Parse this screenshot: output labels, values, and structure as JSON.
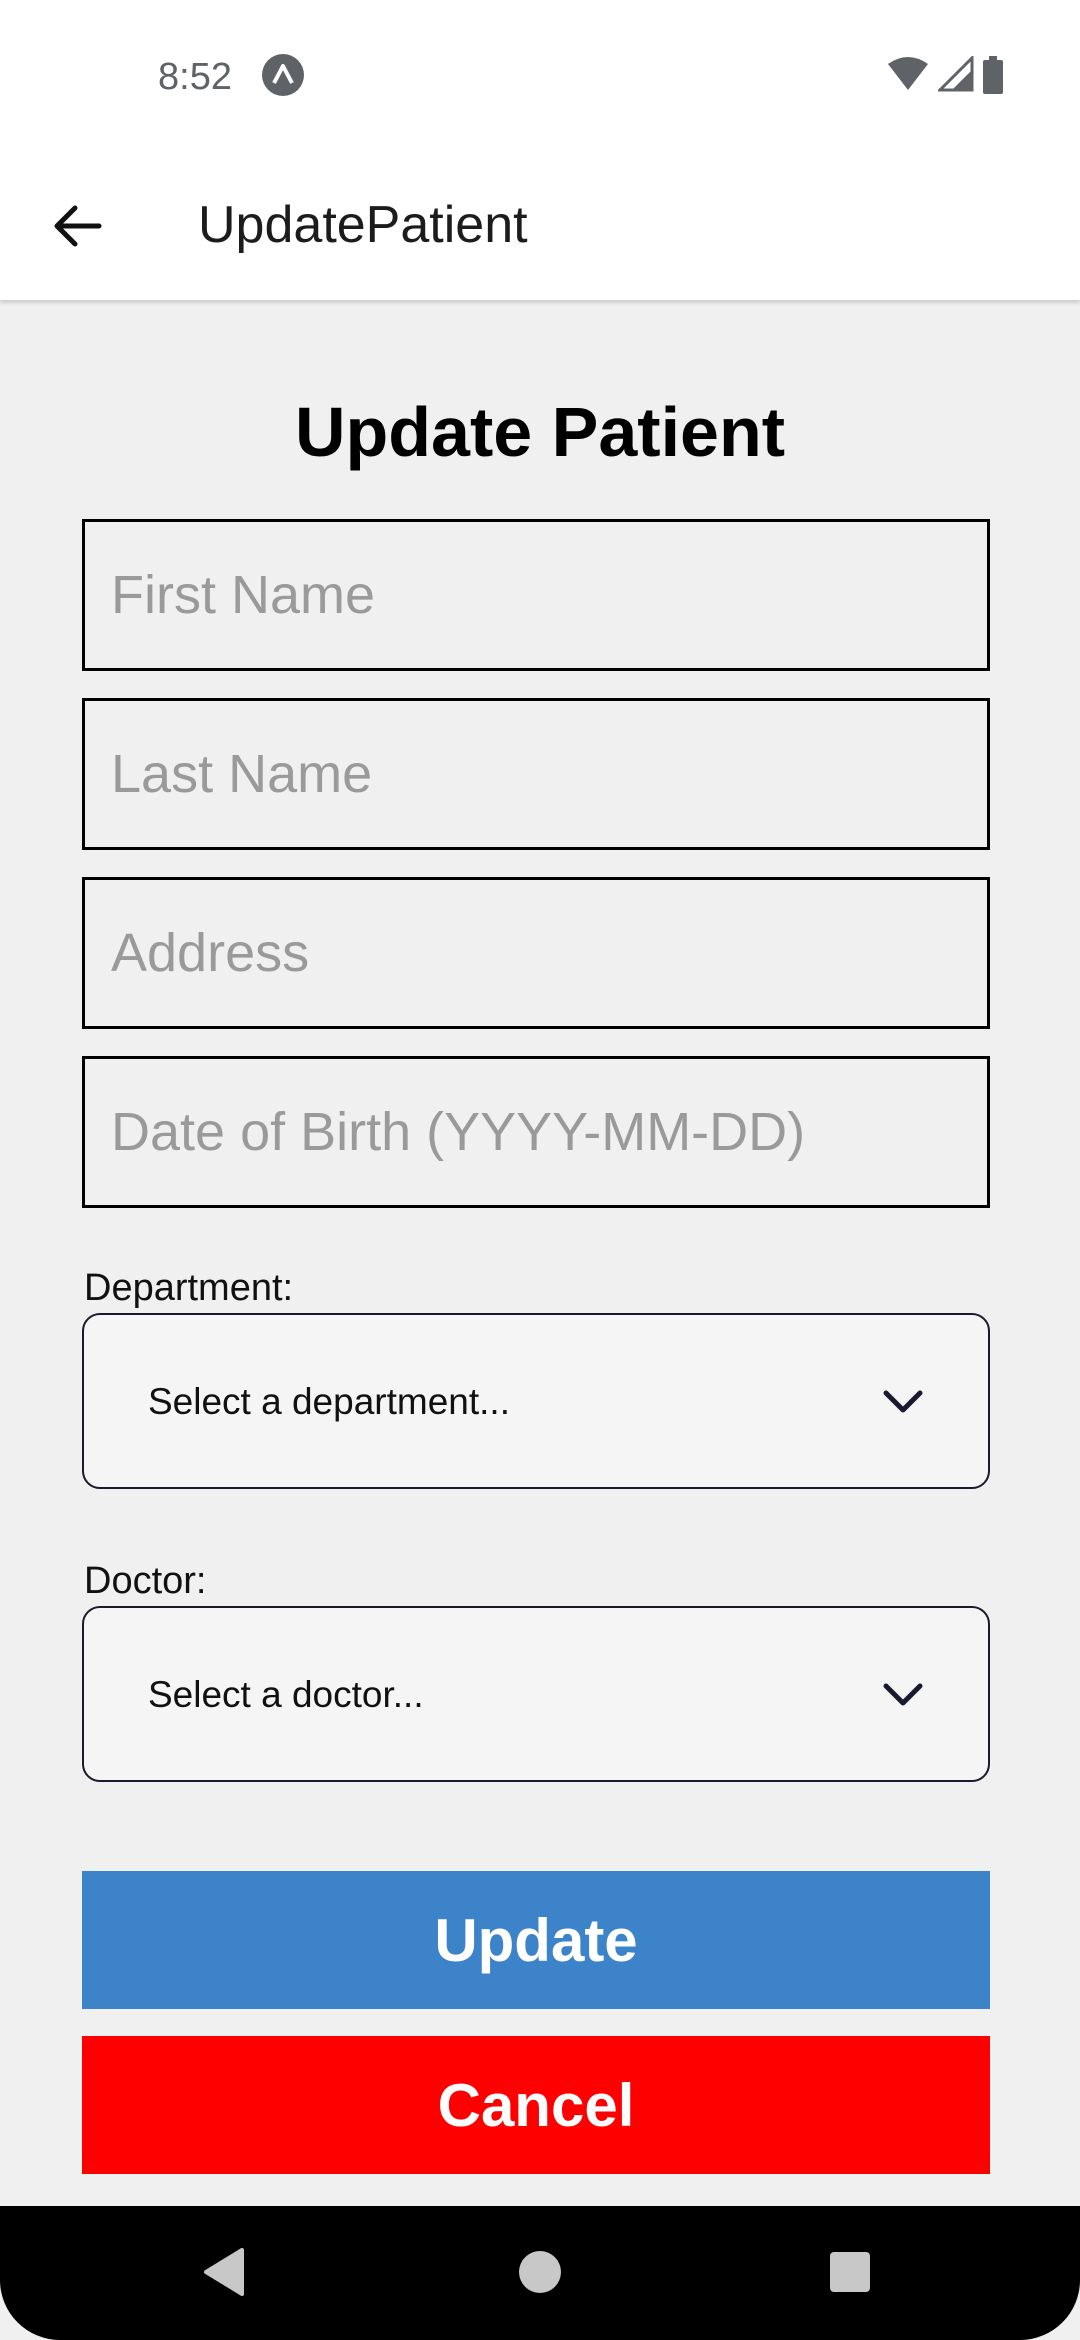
{
  "status_bar": {
    "time": "8:52",
    "app_icon": "expo-icon",
    "icons": [
      "wifi-icon",
      "signal-icon",
      "battery-icon"
    ]
  },
  "app_bar": {
    "back_icon": "arrow-left-icon",
    "title": "UpdatePatient"
  },
  "form": {
    "title": "Update Patient",
    "first_name": {
      "placeholder": "First Name",
      "value": ""
    },
    "last_name": {
      "placeholder": "Last Name",
      "value": ""
    },
    "address": {
      "placeholder": "Address",
      "value": ""
    },
    "dob": {
      "placeholder": "Date of Birth (YYYY-MM-DD)",
      "value": ""
    },
    "department": {
      "label": "Department:",
      "selected": "Select a department..."
    },
    "doctor": {
      "label": "Doctor:",
      "selected": "Select a doctor..."
    },
    "update_label": "Update",
    "cancel_label": "Cancel"
  },
  "colors": {
    "update": "#3d83c9",
    "cancel": "#ff0000",
    "background": "#f0f0f0"
  },
  "nav_bar": {
    "icons": [
      "back-triangle-icon",
      "home-circle-icon",
      "recents-square-icon"
    ]
  }
}
